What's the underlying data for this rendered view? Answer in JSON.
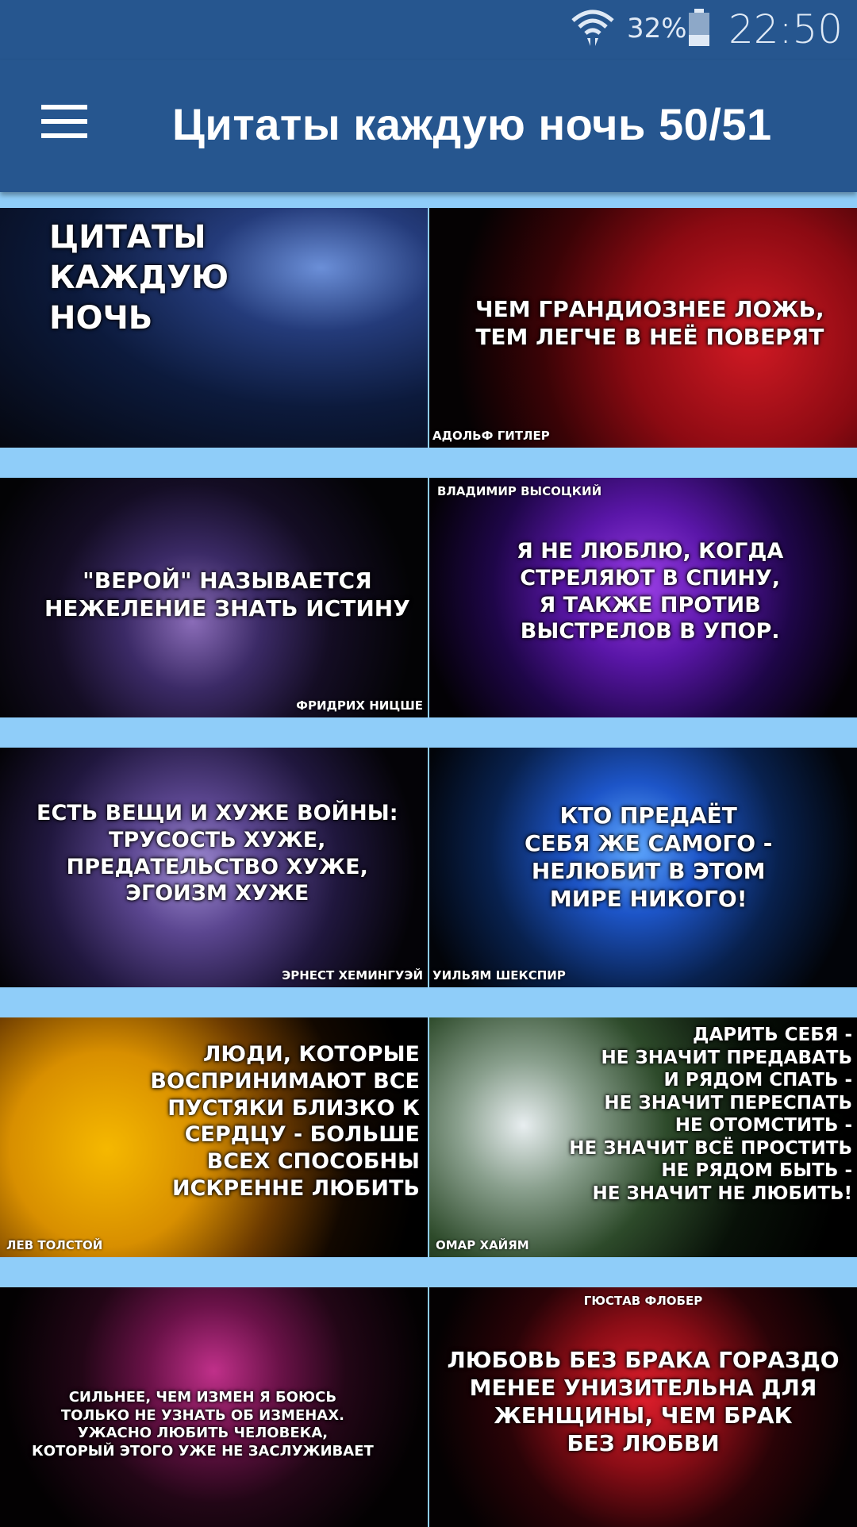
{
  "status": {
    "battery": "32%",
    "time": "22:50"
  },
  "appbar": {
    "title": "Цитаты каждую ночь 50/51"
  },
  "tiles": [
    {
      "quote": "ЦИТАТЫ\n     КАЖДУЮ\n          НОЧЬ",
      "author": ""
    },
    {
      "quote": "ЧЕМ ГРАНДИОЗНЕЕ ЛОЖЬ,\nТЕМ ЛЕГЧЕ В НЕЁ ПОВЕРЯТ",
      "author": "АДОЛЬФ ГИТЛЕР"
    },
    {
      "quote": "\"ВЕРОЙ\" НАЗЫВАЕТСЯ\nНЕЖЕЛЕНИЕ ЗНАТЬ ИСТИНУ",
      "author": "ФРИДРИХ НИЦШЕ"
    },
    {
      "quote": "Я НЕ ЛЮБЛЮ, КОГДА\nСТРЕЛЯЮТ В СПИНУ,\nЯ ТАКЖЕ ПРОТИВ\nВЫСТРЕЛОВ В УПОР.",
      "author": "ВЛАДИМИР ВЫСОЦКИЙ"
    },
    {
      "quote": "ЕСТЬ ВЕЩИ И ХУЖЕ ВОЙНЫ:\nТРУСОСТЬ ХУЖЕ,\nПРЕДАТЕЛЬСТВО ХУЖЕ,\nЭГОИЗМ ХУЖЕ",
      "author": "ЭРНЕСТ ХЕМИНГУЭЙ"
    },
    {
      "quote": "КТО ПРЕДАЁТ\nСЕБЯ ЖЕ САМОГО -\nНЕЛЮБИТ В ЭТОМ\nМИРЕ НИКОГО!",
      "author": "УИЛЬЯМ ШЕКСПИР"
    },
    {
      "quote": "ЛЮДИ, КОТОРЫЕ\nВОСПРИНИМАЮТ ВСЕ\nПУСТЯКИ БЛИЗКО К\nСЕРДЦУ - БОЛЬШЕ\nВСЕХ СПОСОБНЫ\nИСКРЕННЕ ЛЮБИТЬ",
      "author": "ЛЕВ ТОЛСТОЙ"
    },
    {
      "quote": "ДАРИТЬ СЕБЯ -\nНЕ ЗНАЧИТ ПРЕДАВАТЬ\nИ РЯДОМ СПАТЬ -\nНЕ ЗНАЧИТ ПЕРЕСПАТЬ\nНЕ ОТОМСТИТЬ -\nНЕ ЗНАЧИТ ВСЁ ПРОСТИТЬ\nНЕ РЯДОМ БЫТЬ -\nНЕ ЗНАЧИТ НЕ ЛЮБИТЬ!",
      "author": "ОМАР ХАЙЯМ"
    },
    {
      "quote": "СИЛЬНЕЕ, ЧЕМ ИЗМЕН Я БОЮСЬ\nТОЛЬКО НЕ УЗНАТЬ ОБ ИЗМЕНАХ.\nУЖАСНО ЛЮБИТЬ ЧЕЛОВЕКА,\nКОТОРЫЙ ЭТОГО УЖЕ НЕ ЗАСЛУЖИВАЕТ",
      "author": ""
    },
    {
      "quote": "ЛЮБОВЬ БЕЗ БРАКА ГОРАЗДО\nМЕНЕЕ УНИЗИТЕЛЬНА ДЛЯ\nЖЕНЩИНЫ, ЧЕМ БРАК\nБЕЗ ЛЮБВИ",
      "author": "ГЮСТАВ ФЛОБЕР"
    }
  ]
}
